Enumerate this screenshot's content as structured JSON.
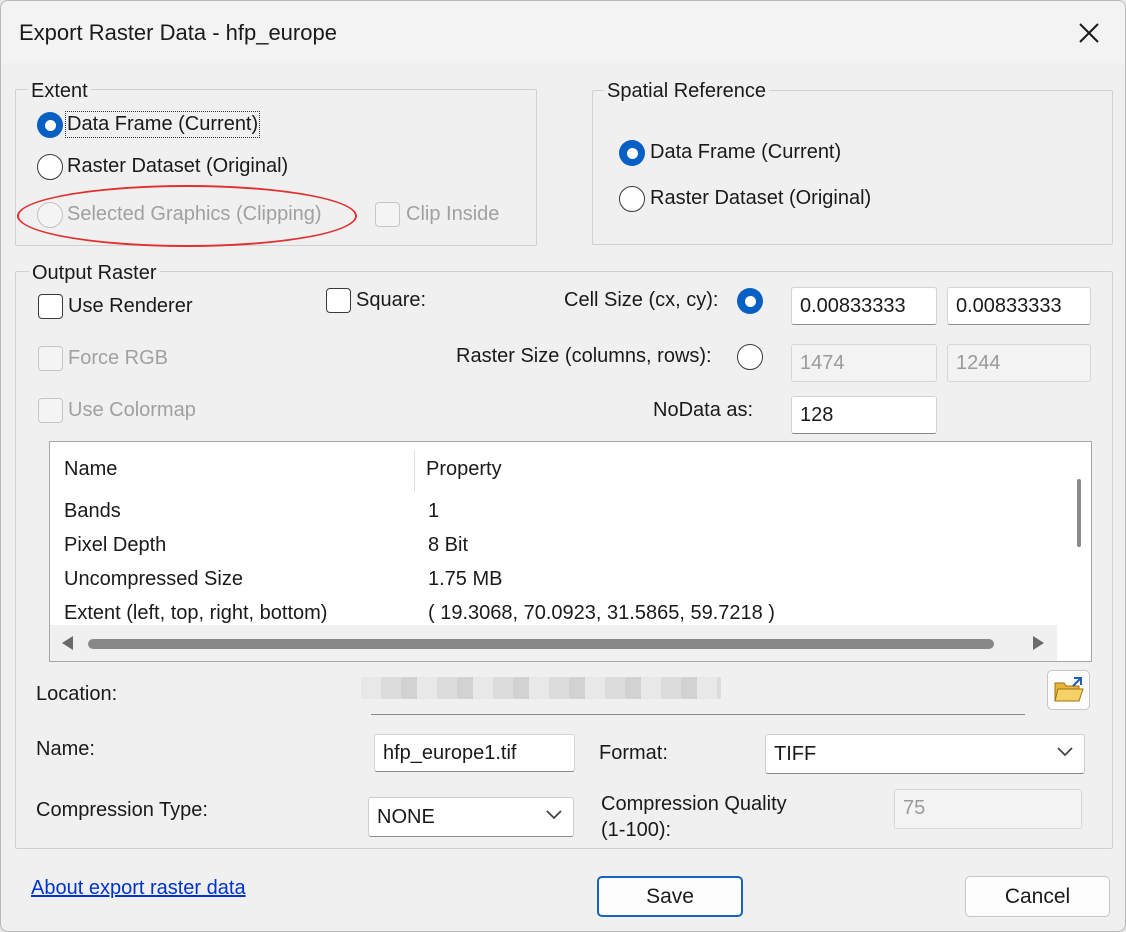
{
  "window": {
    "title": "Export Raster Data - hfp_europe"
  },
  "extent": {
    "legend": "Extent",
    "options": [
      {
        "label": "Data Frame (Current)",
        "checked": true,
        "enabled": true
      },
      {
        "label": "Raster Dataset (Original)",
        "checked": false,
        "enabled": true
      },
      {
        "label": "Selected Graphics (Clipping)",
        "checked": false,
        "enabled": false
      }
    ],
    "clip_inside_label": "Clip Inside"
  },
  "spatial_reference": {
    "legend": "Spatial Reference",
    "options": [
      {
        "label": "Data Frame (Current)",
        "checked": true
      },
      {
        "label": "Raster Dataset (Original)",
        "checked": false
      }
    ]
  },
  "output_raster": {
    "legend": "Output Raster",
    "use_renderer_label": "Use Renderer",
    "force_rgb_label": "Force RGB",
    "use_colormap_label": "Use Colormap",
    "square_label": "Square:",
    "cell_size_label": "Cell Size (cx, cy):",
    "cell_size_cx": "0.00833333",
    "cell_size_cy": "0.00833333",
    "raster_size_label": "Raster Size (columns, rows):",
    "raster_columns": "1474",
    "raster_rows": "1244",
    "nodata_label": "NoData as:",
    "nodata_value": "128"
  },
  "properties": {
    "headers": [
      "Name",
      "Property"
    ],
    "rows": [
      [
        "Bands",
        "1"
      ],
      [
        "Pixel Depth",
        "8 Bit"
      ],
      [
        "Uncompressed Size",
        "1.75 MB"
      ],
      [
        "Extent (left, top, right, bottom)",
        "( 19.3068, 70.0923, 31.5865, 59.7218 )"
      ]
    ]
  },
  "location": {
    "label": "Location:"
  },
  "name": {
    "label": "Name:",
    "value": "hfp_europe1.tif"
  },
  "format": {
    "label": "Format:",
    "value": "TIFF"
  },
  "compression": {
    "type_label": "Compression Type:",
    "type_value": "NONE",
    "quality_label_line1": "Compression Quality",
    "quality_label_line2": "(1-100):",
    "quality_value": "75"
  },
  "footer": {
    "help_link": "About export raster data",
    "save_label": "Save",
    "cancel_label": "Cancel"
  },
  "icons": {
    "close": "close-icon",
    "browse": "folder-open-icon",
    "dropdown": "chevron-down-icon"
  },
  "colors": {
    "accent": "#0860c4",
    "annotation": "#e03030",
    "link": "#0033cc"
  }
}
